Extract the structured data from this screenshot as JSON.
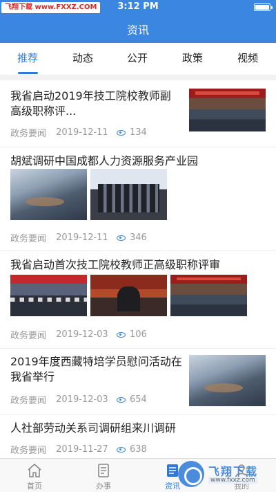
{
  "status_bar": {
    "watermark": "飞翔下载 www.FXXZ.COM",
    "time": "3:12 PM"
  },
  "header": {
    "title": "资讯"
  },
  "tabs": [
    {
      "label": "推荐",
      "active": true
    },
    {
      "label": "动态"
    },
    {
      "label": "公开"
    },
    {
      "label": "政策"
    },
    {
      "label": "视频"
    }
  ],
  "articles": [
    {
      "title": "我省启动2019年技工院校教师副高级职称评...",
      "source": "政务要闻",
      "date": "2019-12-11",
      "views": "134"
    },
    {
      "title": "胡斌调研中国成都人力资源服务产业园",
      "source": "政务要闻",
      "date": "2019-12-11",
      "views": "346"
    },
    {
      "title": "我省启动首次技工院校教师正高级职称评审",
      "source": "政务要闻",
      "date": "2019-12-03",
      "views": "106"
    },
    {
      "title": "2019年度西藏特培学员慰问活动在我省举行",
      "source": "政务要闻",
      "date": "2019-12-03",
      "views": "654"
    },
    {
      "title": "人社部劳动关系司调研组来川调研",
      "source": "政务要闻",
      "date": "2019-11-27",
      "views": "638"
    }
  ],
  "bottom_nav": [
    {
      "label": "首页",
      "icon": "home-icon"
    },
    {
      "label": "办事",
      "icon": "document-icon"
    },
    {
      "label": "资讯",
      "icon": "news-icon",
      "active": true
    },
    {
      "label": "我的",
      "icon": "user-icon"
    }
  ],
  "site_watermark": {
    "name": "飞翔下载",
    "url": "www.fxxz.com"
  },
  "colors": {
    "primary": "#3a86e0",
    "active_tab": "#2f7ad9",
    "meta_text": "#999999"
  }
}
